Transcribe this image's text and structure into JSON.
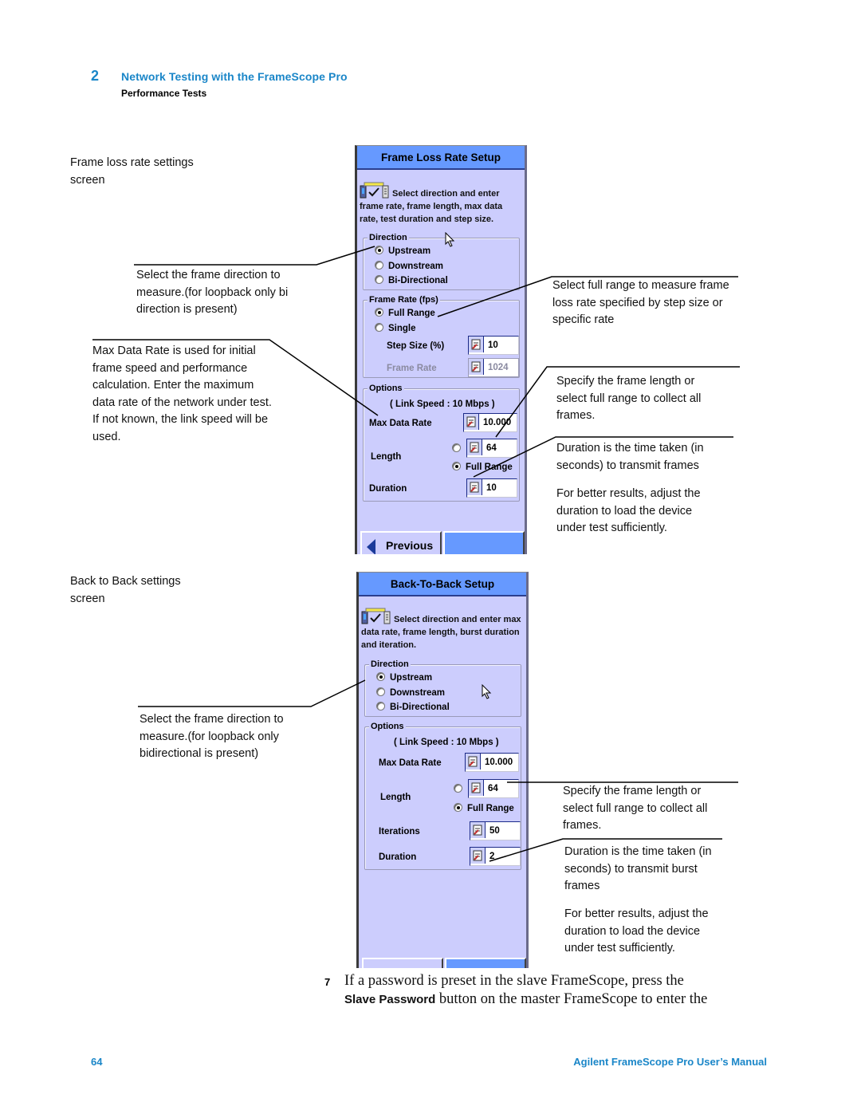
{
  "header": {
    "chapter_number": "2",
    "chapter_title": "Network Testing with the FrameScope Pro",
    "section": "Performance Tests"
  },
  "figure1": {
    "caption": "Frame loss rate settings screen",
    "callouts": {
      "direction": "Select the frame direction to measure.(for loopback only bi direction is present)",
      "max_data_rate": "Max Data Rate is used for initial frame speed and performance calculation. Enter the maximum data rate of the network under test. If not known, the link speed will be used.",
      "full_range": "Select full range to measure frame loss rate specified by step size or specific rate",
      "length": "Specify the frame length or select full range to collect all frames.",
      "duration": "Duration is the time taken (in seconds) to transmit frames",
      "duration_tip": "For better results, adjust the duration to load the device under test sufficiently."
    },
    "screen": {
      "title": "Frame Loss Rate Setup",
      "instruction": "Select direction and enter frame rate, frame length, max data rate, test duration and step size.",
      "direction": {
        "legend": "Direction",
        "options": [
          {
            "label": "Upstream",
            "selected": true
          },
          {
            "label": "Downstream",
            "selected": false
          },
          {
            "label": "Bi-Directional",
            "selected": false
          }
        ]
      },
      "frame_rate": {
        "legend": "Frame Rate (fps)",
        "options": [
          {
            "label": "Full Range",
            "selected": true
          },
          {
            "label": "Single",
            "selected": false
          }
        ],
        "step_size_label": "Step Size (%)",
        "step_size_value": "10",
        "frame_rate_label": "Frame Rate",
        "frame_rate_value": "1024"
      },
      "options": {
        "legend": "Options",
        "link_speed": "( Link Speed : 10 Mbps )",
        "max_data_rate_label": "Max Data Rate",
        "max_data_rate_value": "10.000",
        "length_label": "Length",
        "length_value": "64",
        "length_fixed_selected": false,
        "full_range_label": "Full Range",
        "full_range_selected": true,
        "duration_label": "Duration",
        "duration_value": "10"
      },
      "buttons": {
        "previous": "Previous",
        "next": ""
      }
    }
  },
  "figure2": {
    "caption": "Back to Back settings screen",
    "callouts": {
      "direction": "Select the frame direction to measure.(for loopback only bidirectional is present)",
      "length": "Specify the frame length or select full range to collect all frames.",
      "duration": "Duration is the time taken (in seconds) to transmit burst frames",
      "duration_tip": "For better results, adjust the duration to load the device under test sufficiently."
    },
    "screen": {
      "title": "Back-To-Back Setup",
      "instruction": "Select direction and enter max data rate, frame length, burst duration and iteration.",
      "direction": {
        "legend": "Direction",
        "options": [
          {
            "label": "Upstream",
            "selected": true
          },
          {
            "label": "Downstream",
            "selected": false
          },
          {
            "label": "Bi-Directional",
            "selected": false
          }
        ]
      },
      "options": {
        "legend": "Options",
        "link_speed": "( Link Speed : 10 Mbps )",
        "max_data_rate_label": "Max Data Rate",
        "max_data_rate_value": "10.000",
        "length_label": "Length",
        "length_value": "64",
        "length_fixed_selected": false,
        "full_range_label": "Full Range",
        "full_range_selected": true,
        "iterations_label": "Iterations",
        "iterations_value": "50",
        "duration_label": "Duration",
        "duration_value": "2"
      }
    }
  },
  "step": {
    "number": "7",
    "text_before": "If a password is preset in the slave FrameScope, press the",
    "button_name": "Slave Password",
    "text_after": "button on the master FrameScope to enter the"
  },
  "footer": {
    "page_number": "64",
    "manual_title": "Agilent FrameScope Pro User’s Manual"
  },
  "colors": {
    "accent_blue": "#1a86c8",
    "panel_bg": "#cccdfd",
    "title_bar": "#6699ff"
  }
}
